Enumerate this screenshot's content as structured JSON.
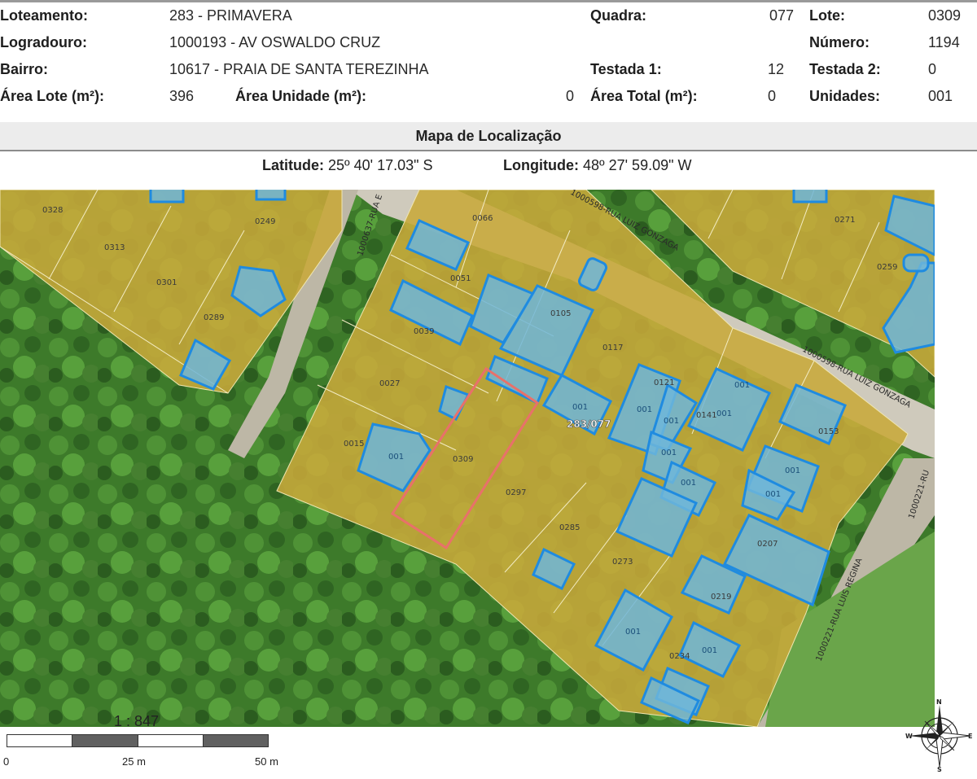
{
  "info": {
    "loteamento_label": "Loteamento:",
    "loteamento_value": "283 - PRIMAVERA",
    "logradouro_label": "Logradouro:",
    "logradouro_value": "1000193 - AV OSWALDO CRUZ",
    "bairro_label": "Bairro:",
    "bairro_value": "10617 - PRAIA DE SANTA TEREZINHA",
    "area_lote_label": "Área Lote (m²):",
    "area_lote_value": "396",
    "area_unidade_label": "Área Unidade (m²):",
    "area_unidade_value": "0",
    "quadra_label": "Quadra:",
    "quadra_value": "077",
    "testada1_label": "Testada 1:",
    "testada1_value": "12",
    "area_total_label": "Área Total (m²):",
    "area_total_value": "0",
    "lote_label": "Lote:",
    "lote_value": "0309",
    "numero_label": "Número:",
    "numero_value": "1194",
    "testada2_label": "Testada 2:",
    "testada2_value": "0",
    "unidades_label": "Unidades:",
    "unidades_value": "001"
  },
  "section_title": "Mapa de Localização",
  "coords": {
    "latitude_label": "Latitude:",
    "latitude_value": "25º 40' 17.03\" S",
    "longitude_label": "Longitude:",
    "longitude_value": "48º 27' 59.09\" W"
  },
  "map": {
    "lot_labels": [
      "0328",
      "0249",
      "0313",
      "0301",
      "0289",
      "0066",
      "0051",
      "0105",
      "0039",
      "0117",
      "0027",
      "0015",
      "0309",
      "0297",
      "0285",
      "0273",
      "0121",
      "0141",
      "0153",
      "0207",
      "0219",
      "0271",
      "0259",
      "0234",
      "283/077"
    ],
    "unit_labels": [
      "001",
      "001",
      "001",
      "001",
      "001",
      "001",
      "001",
      "001",
      "001",
      "001",
      "001",
      "001"
    ],
    "street_labels": [
      "1000598-RUA LUIZ GONZAGA",
      "1000598-RUA LUIZ GONZAGA",
      "1000637-RUA E",
      "1000221-RUA LUIS REGINA",
      "1000221-RU"
    ],
    "colors": {
      "lot_fill": "#c8a83a",
      "building_fill": "#6fb6d9",
      "building_stroke": "#1f8be0",
      "highlight": "#e8716a",
      "vegetation": "#3f7a2c"
    }
  },
  "scale": {
    "ratio": "1 : 847",
    "labels": [
      "0",
      "25 m",
      "50 m"
    ]
  },
  "compass": {
    "n": "N",
    "s": "S",
    "e": "E",
    "w": "W",
    "icon": "compass-rose-icon"
  }
}
